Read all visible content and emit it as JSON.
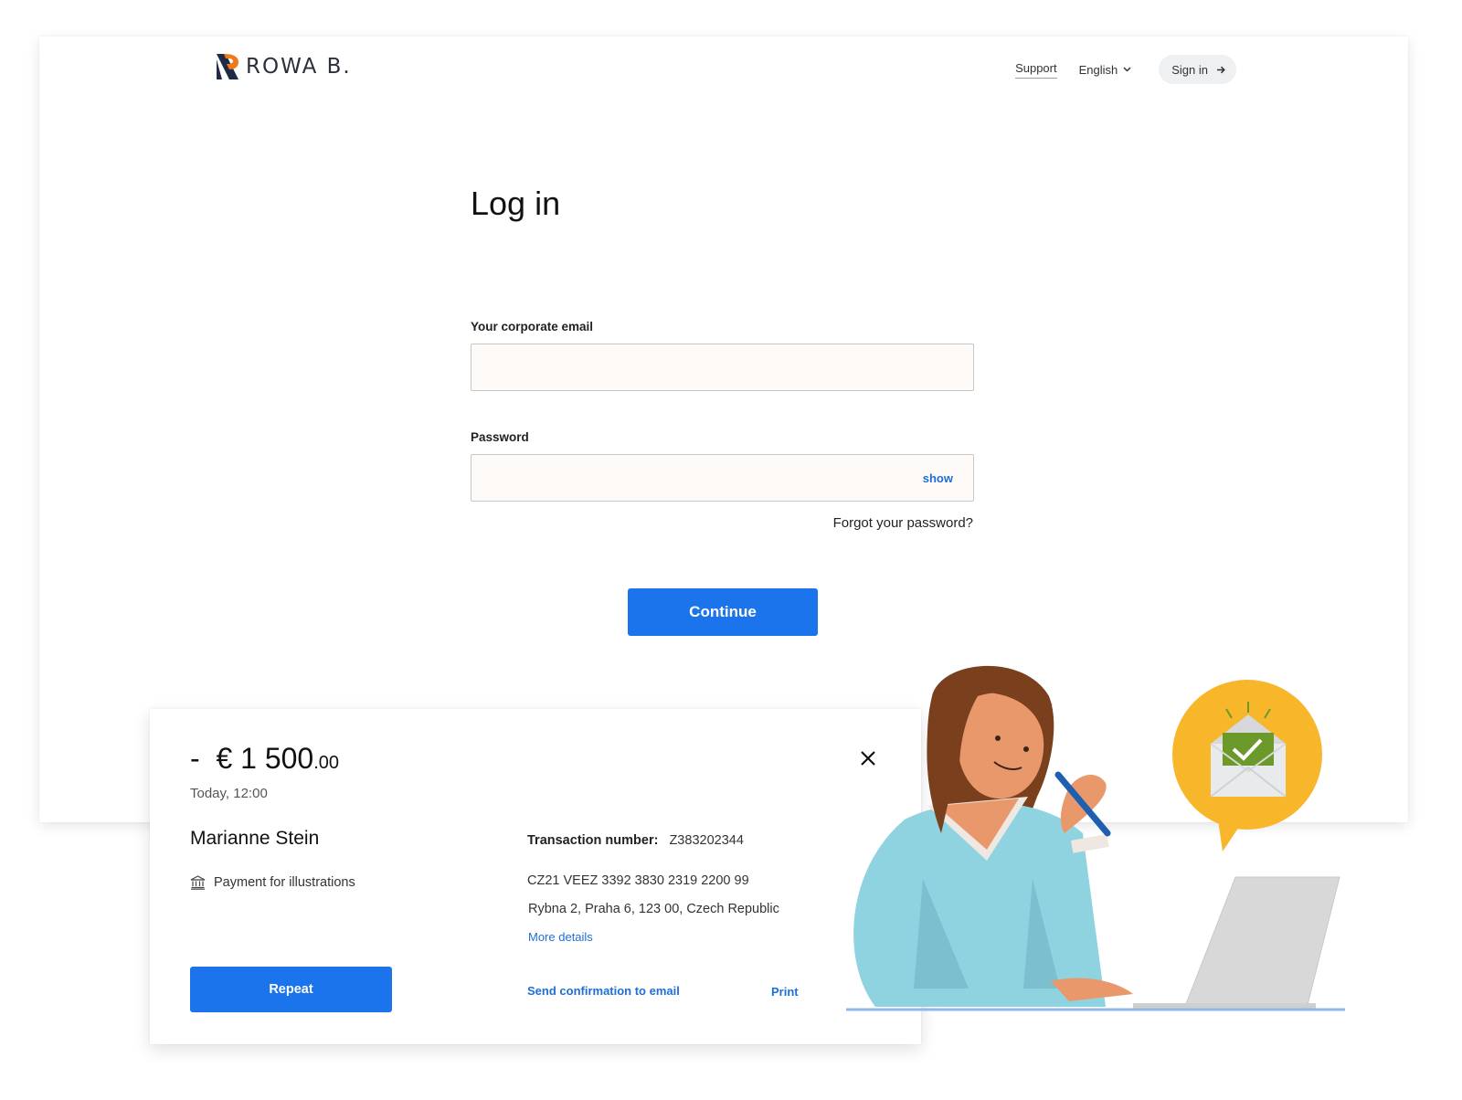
{
  "header": {
    "logo_text": "ROWA B.",
    "nav": {
      "support": "Support",
      "language": "English",
      "sign_in": "Sign in"
    }
  },
  "login": {
    "title": "Log in",
    "email_label": "Your corporate email",
    "email_value": "",
    "password_label": "Password",
    "password_value": "",
    "show_label": "show",
    "forgot_label": "Forgot your password?",
    "continue_label": "Continue"
  },
  "transaction": {
    "amount_sign": "-",
    "amount_main": "€ 1 500",
    "amount_cents": ".00",
    "date": "Today, 12:00",
    "payee": "Marianne Stein",
    "purpose": "Payment for illustrations",
    "number_label": "Transaction number:",
    "number_value": "Z383202344",
    "iban": "CZ21 VEEZ 3392 3830 2319 2200 99",
    "address": "Rybna 2, Praha 6, 123 00, Czech Republic",
    "more_details": "More details",
    "repeat_label": "Repeat",
    "send_confirmation": "Send confirmation to email",
    "print": "Print"
  },
  "colors": {
    "primary": "#1b74eb",
    "link": "#1e6fd6",
    "logo_orange": "#f07a1b",
    "logo_navy": "#1f2a44",
    "bubble_yellow": "#f8b62a",
    "envelope_green": "#6b9a2a",
    "sweater_blue": "#8fd3e0"
  },
  "icons": {
    "language_chevron": "chevron-down-icon",
    "sign_in_arrow": "arrow-right-icon",
    "close": "close-icon",
    "bank": "bank-icon",
    "mail_check": "mail-check-icon"
  }
}
